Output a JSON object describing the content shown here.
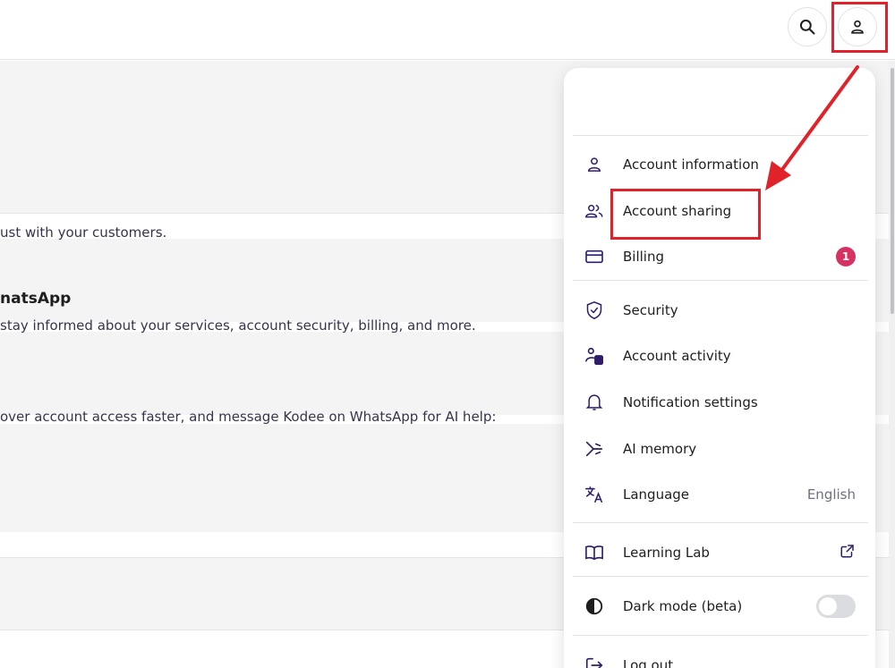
{
  "header": {
    "search_icon": "search-icon",
    "account_icon": "user-icon"
  },
  "background": {
    "line1": "ust with your customers.",
    "heading2": "natsApp",
    "line2": "stay informed about your services, account security, billing, and more.",
    "line3": "over account access faster, and message Kodee on WhatsApp for AI help:"
  },
  "menu": {
    "items": [
      {
        "label": "Account information",
        "icon": "user-icon"
      },
      {
        "label": "Account sharing",
        "icon": "users-icon"
      },
      {
        "label": "Billing",
        "icon": "credit-card-icon",
        "badge": "1"
      },
      {
        "label": "Security",
        "icon": "shield-check-icon"
      },
      {
        "label": "Account activity",
        "icon": "account-activity-icon"
      },
      {
        "label": "Notification settings",
        "icon": "bell-icon"
      },
      {
        "label": "AI memory",
        "icon": "ai-memory-icon"
      },
      {
        "label": "Language",
        "icon": "translate-icon",
        "value": "English"
      },
      {
        "label": "Learning Lab",
        "icon": "book-icon",
        "trailing_icon": "external-link-icon"
      },
      {
        "label": "Dark mode (beta)",
        "icon": "contrast-icon",
        "toggle_on": false
      },
      {
        "label": "Log out",
        "icon": "logout-icon"
      }
    ]
  },
  "colors": {
    "annotation_red": "#e0222a",
    "badge_pink": "#d63163",
    "icon_purple": "#2f1c6a"
  }
}
